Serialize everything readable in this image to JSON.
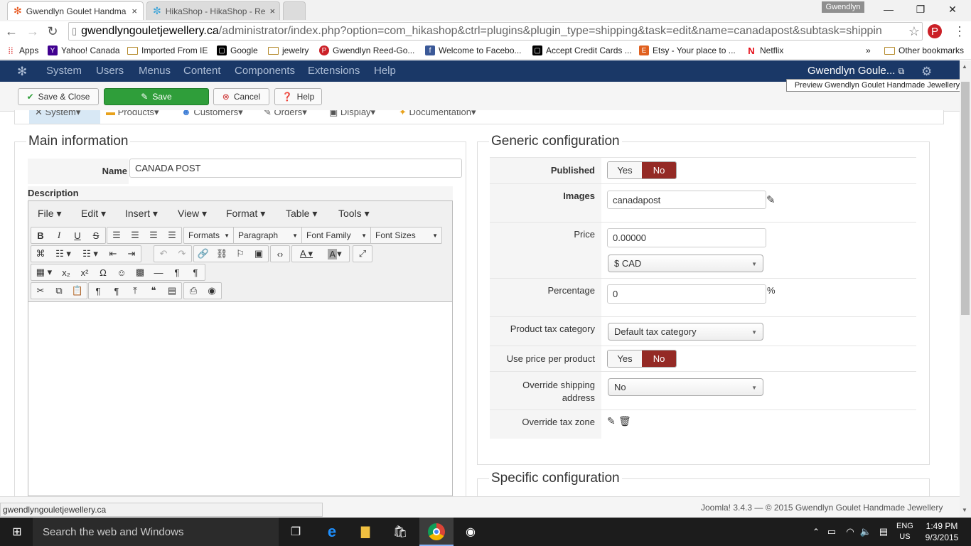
{
  "browser": {
    "tabs": [
      {
        "title": "Gwendlyn Goulet Handma",
        "active": true
      },
      {
        "title": "HikaShop - HikaShop - Re",
        "active": false
      }
    ],
    "user": "Gwendlyn",
    "url_host": "gwendlyngouletjewellery.ca",
    "url_rest": "/administrator/index.php?option=com_hikashop&ctrl=plugins&plugin_type=shipping&task=edit&name=canadapost&subtask=shippin",
    "bookmarks": [
      "Apps",
      "Yahoo! Canada",
      "Imported From IE",
      "Google",
      "jewelry",
      "Gwendlyn Reed-Go...",
      "Welcome to Facebo...",
      "Accept Credit Cards ...",
      "Etsy - Your place to ...",
      "Netflix"
    ],
    "more": "»",
    "other_bookmarks": "Other bookmarks",
    "status_url": "gwendlyngouletjewellery.ca"
  },
  "joomla": {
    "nav": [
      "System",
      "Users",
      "Menus",
      "Content",
      "Components",
      "Extensions",
      "Help"
    ],
    "site_name": "Gwendlyn Goule...",
    "tooltip": "Preview Gwendlyn Goulet Handmade Jewellery",
    "toolbar": {
      "save_close": "Save & Close",
      "save": "Save",
      "cancel": "Cancel",
      "help": "Help"
    },
    "submenu": [
      "System",
      "Products",
      "Customers",
      "Orders",
      "Display",
      "Documentation"
    ],
    "footer": "Joomla! 3.4.3 — © 2015 Gwendlyn Goulet Handmade Jewellery"
  },
  "main_info": {
    "legend": "Main information",
    "name_label": "Name",
    "name_value": "CANADA POST",
    "description_label": "Description",
    "editor_menus": [
      "File",
      "Edit",
      "Insert",
      "View",
      "Format",
      "Table",
      "Tools"
    ],
    "editor_selects": [
      "Formats",
      "Paragraph",
      "Font Family",
      "Font Sizes"
    ]
  },
  "generic": {
    "legend": "Generic configuration",
    "published_label": "Published",
    "yes": "Yes",
    "no": "No",
    "images_label": "Images",
    "images_value": "canadapost",
    "price_label": "Price",
    "price_value": "0.00000",
    "currency": "$ CAD",
    "percentage_label": "Percentage",
    "percentage_value": "0",
    "percent_sign": "%",
    "tax_label": "Product tax category",
    "tax_value": "Default tax category",
    "per_product_label": "Use price per product",
    "override_address_label": "Override shipping address",
    "override_address_value": "No",
    "override_tax_label": "Override tax zone"
  },
  "specific": {
    "legend": "Specific configuration"
  },
  "taskbar": {
    "search": "Search the web and Windows",
    "lang1": "ENG",
    "lang2": "US",
    "time": "1:49 PM",
    "date": "9/3/2015"
  }
}
